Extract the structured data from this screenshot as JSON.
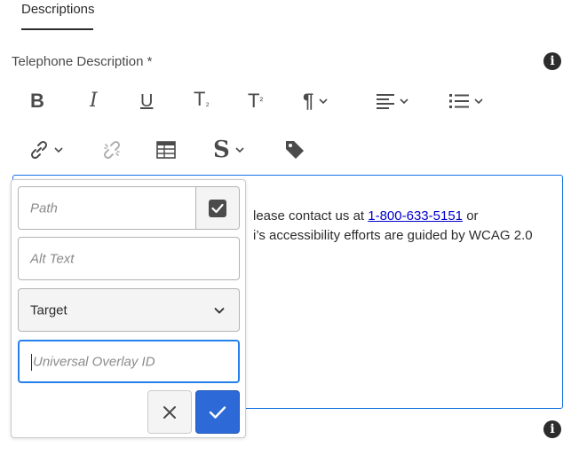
{
  "tabs": {
    "active_label": "Descriptions"
  },
  "field": {
    "label": "Telephone Description *"
  },
  "toolbar": {
    "bold": "B",
    "italic": "I",
    "underline": "U",
    "subscript": "T",
    "subscript_mark": "₂",
    "superscript": "T",
    "superscript_mark": "²",
    "paragraph": "¶",
    "styles": "S",
    "icons": [
      "bold-icon",
      "italic-icon",
      "underline-icon",
      "subscript-icon",
      "superscript-icon",
      "paragraph-format-icon",
      "align-left-icon",
      "list-icon",
      "link-icon",
      "unlink-icon",
      "table-icon",
      "style-icon",
      "tag-icon"
    ]
  },
  "editor": {
    "line1_before_link": "lease contact us at",
    "line1_link": "1-800-633-5151",
    "line1_after_link": "or",
    "line2": "i’s accessibility efforts are guided by WCAG 2.0"
  },
  "link_dialog": {
    "path_placeholder": "Path",
    "alt_text_placeholder": "Alt Text",
    "target_value": "Target",
    "overlay_placeholder": "Universal Overlay ID"
  },
  "colors": {
    "accent": "#2d6ad8",
    "focus_border": "#2680eb",
    "text": "#2c2c2c",
    "link": "#0000cc"
  }
}
